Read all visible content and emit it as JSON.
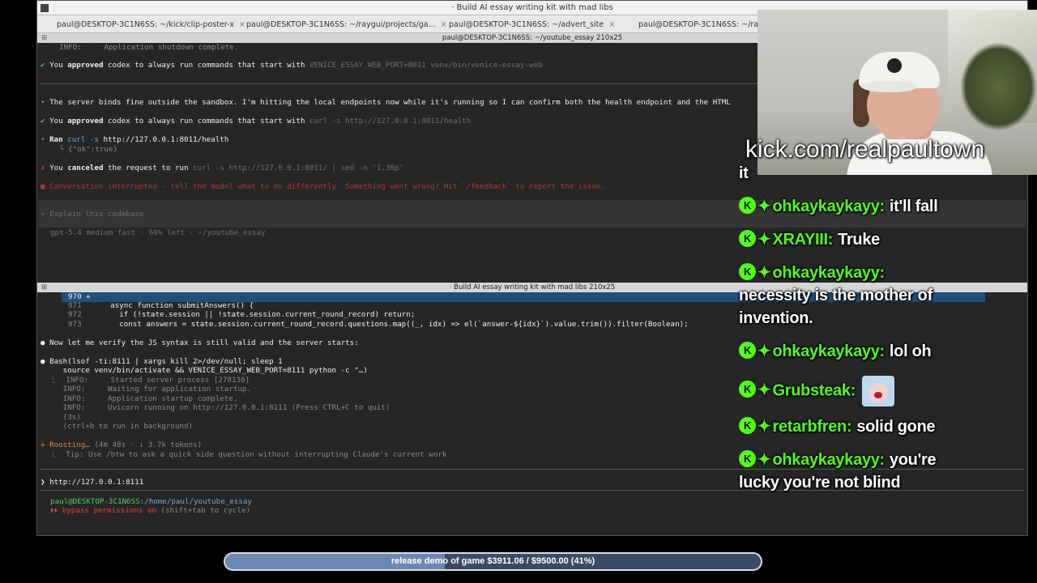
{
  "window": {
    "title": "· Build AI essay writing kit with mad libs",
    "tabs": [
      {
        "label": "paul@DESKTOP-3C1N6SS: ~/kick/clip-poster-x"
      },
      {
        "label": "paul@DESKTOP-3C1N6SS: ~/raygui/projects/ga..."
      },
      {
        "label": "paul@DESKTOP-3C1N6SS: ~/advert_site"
      },
      {
        "label": "paul@DESKTOP-3C1N6SS: ~/raygui"
      }
    ],
    "tab_close": "×"
  },
  "top_pane": {
    "header": "paul@DESKTOP-3C1N6SS: ~/youtube_essay 210x25",
    "lines": {
      "l1": "  INFO:     Application shutdown complete.",
      "l2_mark": "✔",
      "l2_a": " You ",
      "l2_b": "approved",
      "l2_c": " codex to always run commands that start with ",
      "l2_d": "VENICE_ESSAY_WEB_PORT=8011 venv/bin/venice-essay-web",
      "l3_mark": "•",
      "l3": " The server binds fine outside the sandbox. I'm hitting the local endpoints now while it's running so I can confirm both the health endpoint and the HTML",
      "l4_mark": "✔",
      "l4_a": " You ",
      "l4_b": "approved",
      "l4_c": " codex to always run commands that start with ",
      "l4_d": "curl -s http://127.0.0.1:8011/health",
      "l5_mark": "•",
      "l5_a": " Ran ",
      "l5_b": "curl -s",
      "l5_c": " http://127.0.0.1:8011/health",
      "l6": "  └ {\"ok\":true}",
      "l7_mark": "✗",
      "l7_a": " You ",
      "l7_b": "canceled",
      "l7_c": " the request to run ",
      "l7_d": "curl -s http://127.0.0.1:8011/ | sed -n '1,30p'",
      "l8": "■ Conversation interrupted - tell the model what to do differently. Something went wrong? Hit `/feedback` to report the issue.",
      "prompt_mark": "›",
      "prompt_placeholder": "Explain this codebase",
      "status": "gpt-5.4 medium fast · 60% left · ~/youtube_essay"
    }
  },
  "bottom_pane": {
    "header": "· Build AI essay writing kit with mad libs 210x25",
    "code": {
      "n970": "970 +",
      "n971": "971",
      "c971": "    async function submitAnswers() {",
      "n972": "972",
      "c972": "      if (!state.session || !state.session.current_round_record) return;",
      "n973": "973",
      "c973": "      const answers = state.session.current_round_record.questions.map((_, idx) => el(`answer-${idx}`).value.trim()).filter(Boolean);"
    },
    "lines": {
      "verify": "● Now let me verify the JS syntax is still valid and the server starts:",
      "bash": "● Bash(lsof -ti:8111 | xargs kill 2>/dev/null; sleep 1",
      "bash2": "     source venv/bin/activate && VENICE_ESSAY_WEB_PORT=8111 python -c \"…)",
      "o1": "  ⎿  INFO:     Started server process [278130]",
      "o2": "     INFO:     Waiting for application startup.",
      "o3": "     INFO:     Application startup complete.",
      "o4": "     INFO:     Uvicorn running on http://127.0.0.1:8111 (Press CTRL+C to quit)",
      "o5": "     (3s)",
      "o6": "     (ctrl+b to run in background)",
      "roost_a": "✢ Roosting…",
      "roost_b": " (4m 48s · ↓ 3.7k tokens)",
      "tip": "  ⎿  Tip: Use /btw to ask a quick side question without interrupting Claude's current work",
      "input_mark": "❯",
      "input_value": "http://127.0.0.1:8111",
      "cwd_user": "paul@DESKTOP-3C1N6SS",
      "cwd_path": ":/home/paul/youtube_essay",
      "bypass_a": "⏵⏵",
      "bypass_b": " bypass permissions on",
      "bypass_c": " (shift+tab to cycle)"
    }
  },
  "overlay": {
    "url": "kick.com/realpaultown",
    "fragment": "it",
    "messages": [
      {
        "user": "ohkaykaykayy:",
        "text": "it'll fall"
      },
      {
        "user": "XRAYIII:",
        "text": "Truke"
      },
      {
        "user": "ohkaykaykayy:",
        "text": "",
        "cont1": "necessity is the mother of",
        "cont2": "invention."
      },
      {
        "user": "ohkaykaykayy:",
        "text": "lol oh"
      },
      {
        "user": "Grubsteak:",
        "text": ""
      },
      {
        "user": "retarbfren:",
        "text": "solid gone"
      },
      {
        "user": "ohkaykaykayy:",
        "text": "you're",
        "cont1": "lucky you're not blind"
      }
    ],
    "badge_color": "#53fc18"
  },
  "goal": {
    "label": "release demo of game $3911.06 / $9500.00 (41%)",
    "progress_fraction": 0.41
  }
}
